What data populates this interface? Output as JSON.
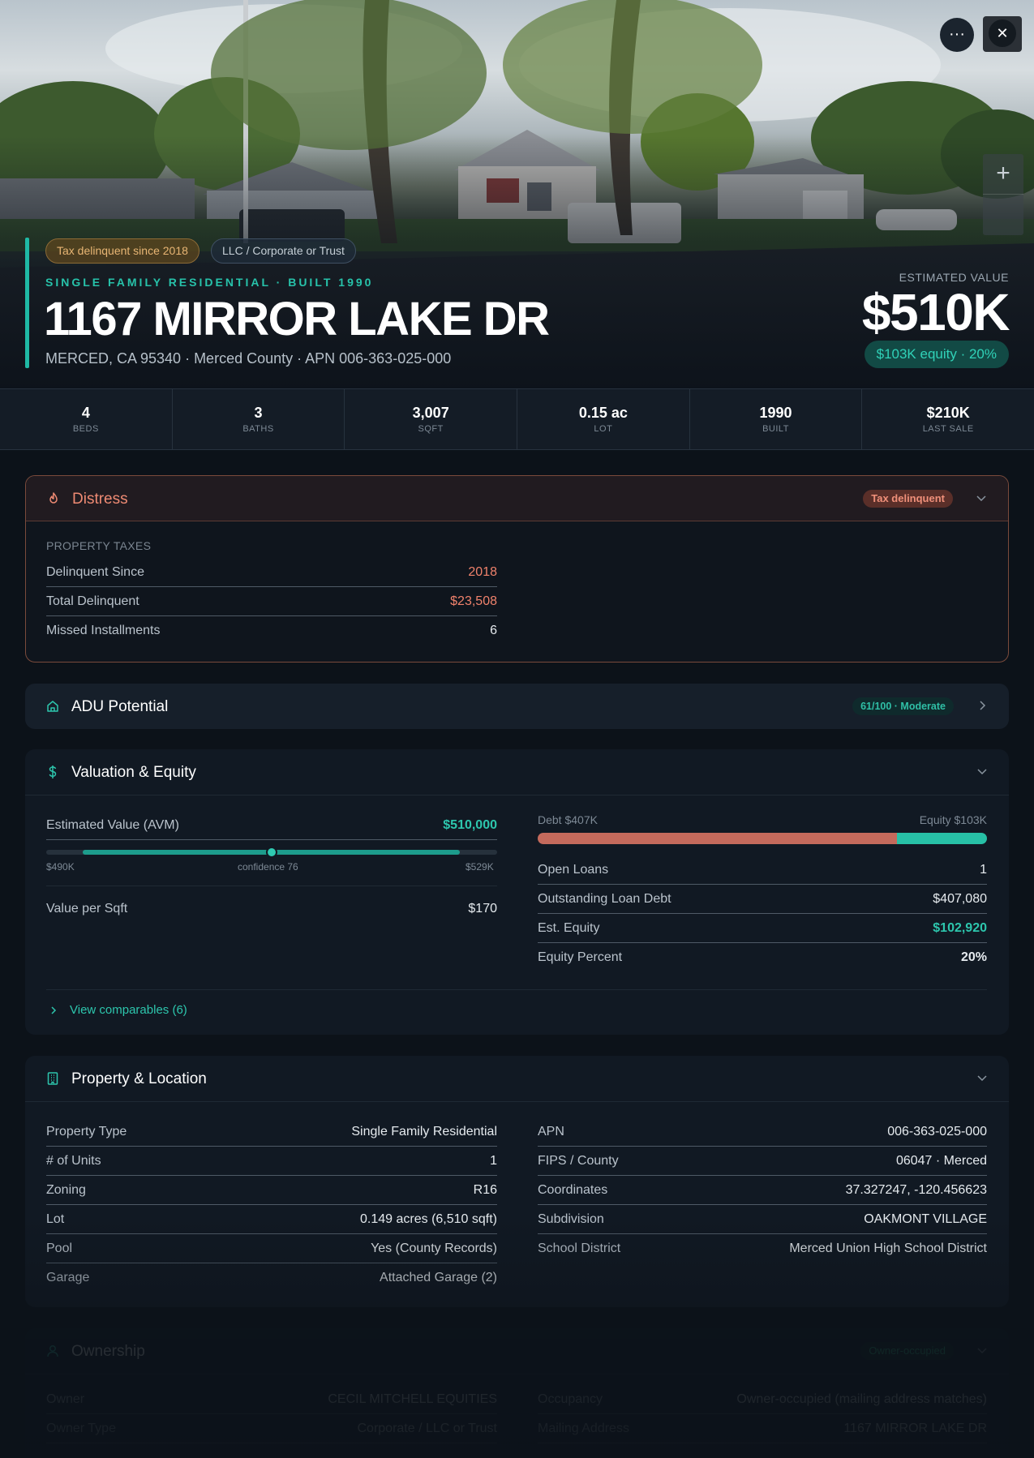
{
  "hero": {
    "badge_tax": "Tax delinquent since 2018",
    "badge_owner_type": "LLC / Corporate or Trust",
    "subtitle": "SINGLE FAMILY RESIDENTIAL · BUILT 1990",
    "address": "1167 MIRROR LAKE DR",
    "location": "MERCED, CA 95340 · Merced County · APN 006-363-025-000",
    "est_label": "ESTIMATED VALUE",
    "est_value": "$510K",
    "equity_badge": "$103K equity · 20%",
    "more_icon": "more-horizontal-icon",
    "close_icon": "close-icon",
    "zoom_in": "+",
    "more_glyph": "···",
    "close_glyph": "✕"
  },
  "stats": [
    {
      "value": "4",
      "label": "BEDS"
    },
    {
      "value": "3",
      "label": "BATHS"
    },
    {
      "value": "3,007",
      "label": "SQFT"
    },
    {
      "value": "0.15 ac",
      "label": "LOT"
    },
    {
      "value": "1990",
      "label": "BUILT"
    },
    {
      "value": "$210K",
      "label": "LAST SALE"
    }
  ],
  "distress": {
    "title": "Distress",
    "icon": "flame-icon",
    "badge": "Tax delinquent",
    "section_label": "PROPERTY TAXES",
    "rows": [
      {
        "label": "Delinquent Since",
        "value": "2018"
      },
      {
        "label": "Total Delinquent",
        "value": "$23,508"
      },
      {
        "label": "Missed Installments",
        "value": "6"
      }
    ]
  },
  "adu": {
    "title": "ADU Potential",
    "icon": "home-icon",
    "badge": "61/100 · Moderate"
  },
  "valuation": {
    "title": "Valuation & Equity",
    "icon": "dollar-icon",
    "avm_label": "Estimated Value (AVM)",
    "avm_value": "$510,000",
    "range_low": "$490K",
    "range_high": "$529K",
    "confidence": "confidence 76",
    "confidence_value": 76,
    "vps_label": "Value per Sqft",
    "vps_value": "$170",
    "debt_label": "Debt $407K",
    "equity_label": "Equity $103K",
    "debt_fraction": 0.8,
    "rows": [
      {
        "label": "Open Loans",
        "value": "1"
      },
      {
        "label": "Outstanding Loan Debt",
        "value": "$407,080"
      },
      {
        "label": "Est. Equity",
        "value": "$102,920"
      },
      {
        "label": "Equity Percent",
        "value": "20%"
      }
    ],
    "comparables_link": "View comparables (6)"
  },
  "property": {
    "title": "Property & Location",
    "icon": "building-icon",
    "left": [
      {
        "label": "Property Type",
        "value": "Single Family Residential"
      },
      {
        "label": "# of Units",
        "value": "1"
      },
      {
        "label": "Zoning",
        "value": "R16"
      },
      {
        "label": "Lot",
        "value": "0.149 acres (6,510 sqft)"
      },
      {
        "label": "Pool",
        "value": "Yes (County Records)"
      },
      {
        "label": "Garage",
        "value": "Attached Garage (2)"
      }
    ],
    "right": [
      {
        "label": "APN",
        "value": "006-363-025-000"
      },
      {
        "label": "FIPS / County",
        "value": "06047 · Merced"
      },
      {
        "label": "Coordinates",
        "value": "37.327247, -120.456623"
      },
      {
        "label": "Subdivision",
        "value": "OAKMONT VILLAGE"
      },
      {
        "label": "School District",
        "value": "Merced Union High School District"
      }
    ]
  },
  "ownership": {
    "title": "Ownership",
    "icon": "user-icon",
    "badge": "Owner-occupied",
    "left": [
      {
        "label": "Owner",
        "value": "CECIL MITCHELL EQUITIES"
      },
      {
        "label": "Owner Type",
        "value": "Corporate / LLC or Trust"
      }
    ],
    "right": [
      {
        "label": "Occupancy",
        "value": "Owner-occupied (mailing address matches)"
      },
      {
        "label": "Mailing Address",
        "value": "1167 MIRROR LAKE DR"
      }
    ]
  },
  "colors": {
    "accent": "#1fb9a5",
    "distress": "#f0826c",
    "debt": "#c46a5c",
    "equity": "#27c0a6"
  }
}
